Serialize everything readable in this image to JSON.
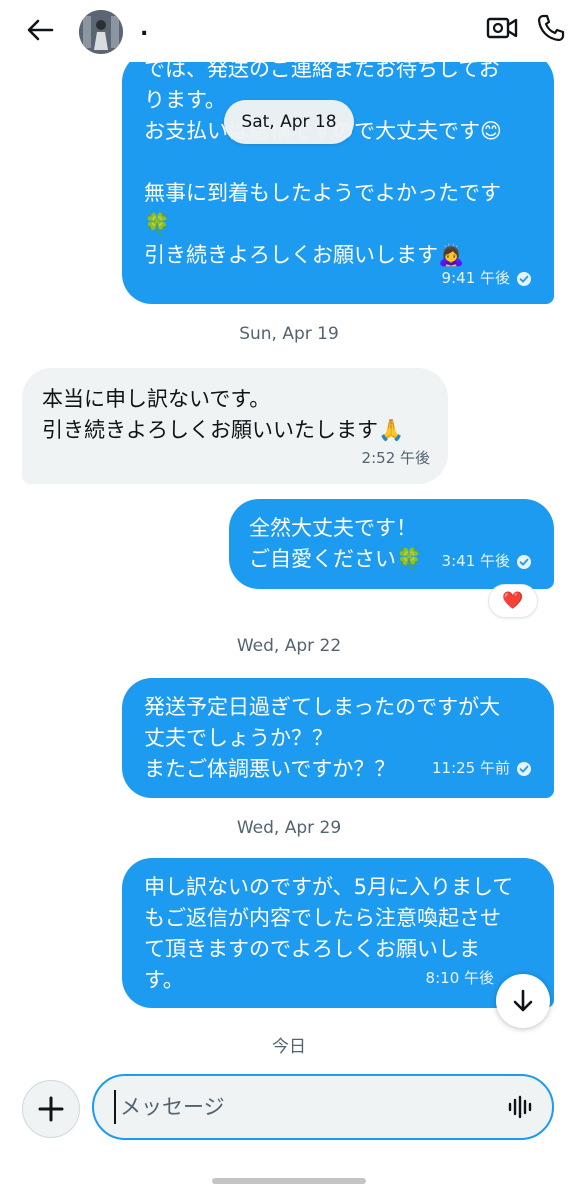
{
  "header": {
    "contact_name": ".",
    "back_icon": "arrow-left-icon",
    "video_icon": "video-camera-icon",
    "call_icon": "phone-icon"
  },
  "floating_date": "Sat, Apr 18",
  "messages": [
    {
      "direction": "out",
      "lines": [
        "では、発送のご連絡またお待ちしてお",
        "ります。",
        "お支払いは結構ですので大丈夫です😊",
        "",
        "無事に到着もしたようでよかったです",
        "🍀",
        "引き続きよろしくお願いします🙇‍♀️"
      ],
      "time": "9:41 午後",
      "read": true
    },
    {
      "date_separator": "Sun, Apr 19"
    },
    {
      "direction": "in",
      "lines": [
        "本当に申し訳ないです。",
        "引き続きよろしくお願いいたします🙏"
      ],
      "time": "2:52 午後"
    },
    {
      "direction": "out",
      "lines": [
        "全然大丈夫です！",
        "ご自愛ください🍀"
      ],
      "time": "3:41 午後",
      "read": true,
      "reaction": "❤️"
    },
    {
      "date_separator": "Wed, Apr 22"
    },
    {
      "direction": "out",
      "lines": [
        "発送予定日過ぎてしまったのですが大",
        "丈夫でしょうか？？",
        "またご体調悪いですか？？"
      ],
      "time": "11:25 午前",
      "read": true
    },
    {
      "date_separator": "Wed, Apr 29"
    },
    {
      "direction": "out",
      "lines": [
        "申し訳ないのですが、5月に入りまして",
        "もご返信が内容でしたら注意喚起させ",
        "て頂きますのでよろしくお願いしま",
        "す。"
      ],
      "time": "8:10 午後"
    },
    {
      "date_separator": "今日"
    }
  ],
  "composer": {
    "placeholder": "メッセージ",
    "add_icon": "plus-icon",
    "voice_icon": "voice-waveform-icon"
  },
  "scroll_down_icon": "arrow-down-icon",
  "colors": {
    "accent": "#1d9bf0",
    "incoming_bubble": "#eff3f4",
    "secondary_text": "#536471",
    "heart": "#e0245e"
  }
}
